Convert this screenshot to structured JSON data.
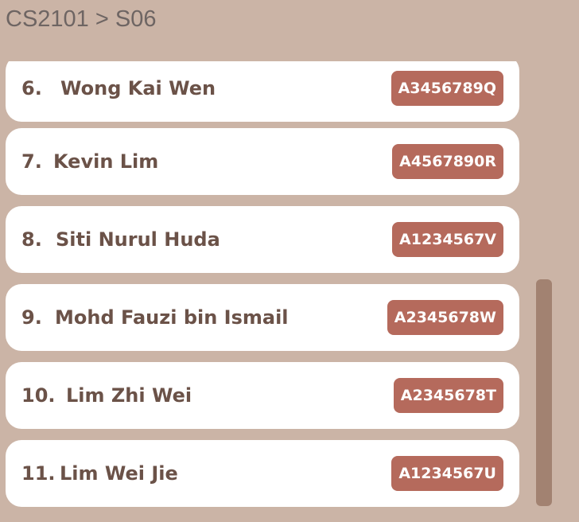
{
  "breadcrumb": {
    "text": "CS2101 > S06"
  },
  "students": [
    {
      "index": "6.",
      "name": "Wong Kai Wen",
      "id": "A3456789Q"
    },
    {
      "index": "7.",
      "name": "Kevin Lim",
      "id": "A4567890R"
    },
    {
      "index": "8.",
      "name": "Siti Nurul Huda",
      "id": "A1234567V"
    },
    {
      "index": "9.",
      "name": "Mohd Fauzi bin Ismail",
      "id": "A2345678W"
    },
    {
      "index": "10.",
      "name": "Lim Zhi Wei",
      "id": "A2345678T"
    },
    {
      "index": "11.",
      "name": "Lim Wei Jie",
      "id": "A1234567U"
    }
  ],
  "colors": {
    "background": "#cbb4a6",
    "card": "#ffffff",
    "badge": "#b56a5c",
    "name_text": "#6b5248",
    "scrollbar": "#a28271"
  }
}
